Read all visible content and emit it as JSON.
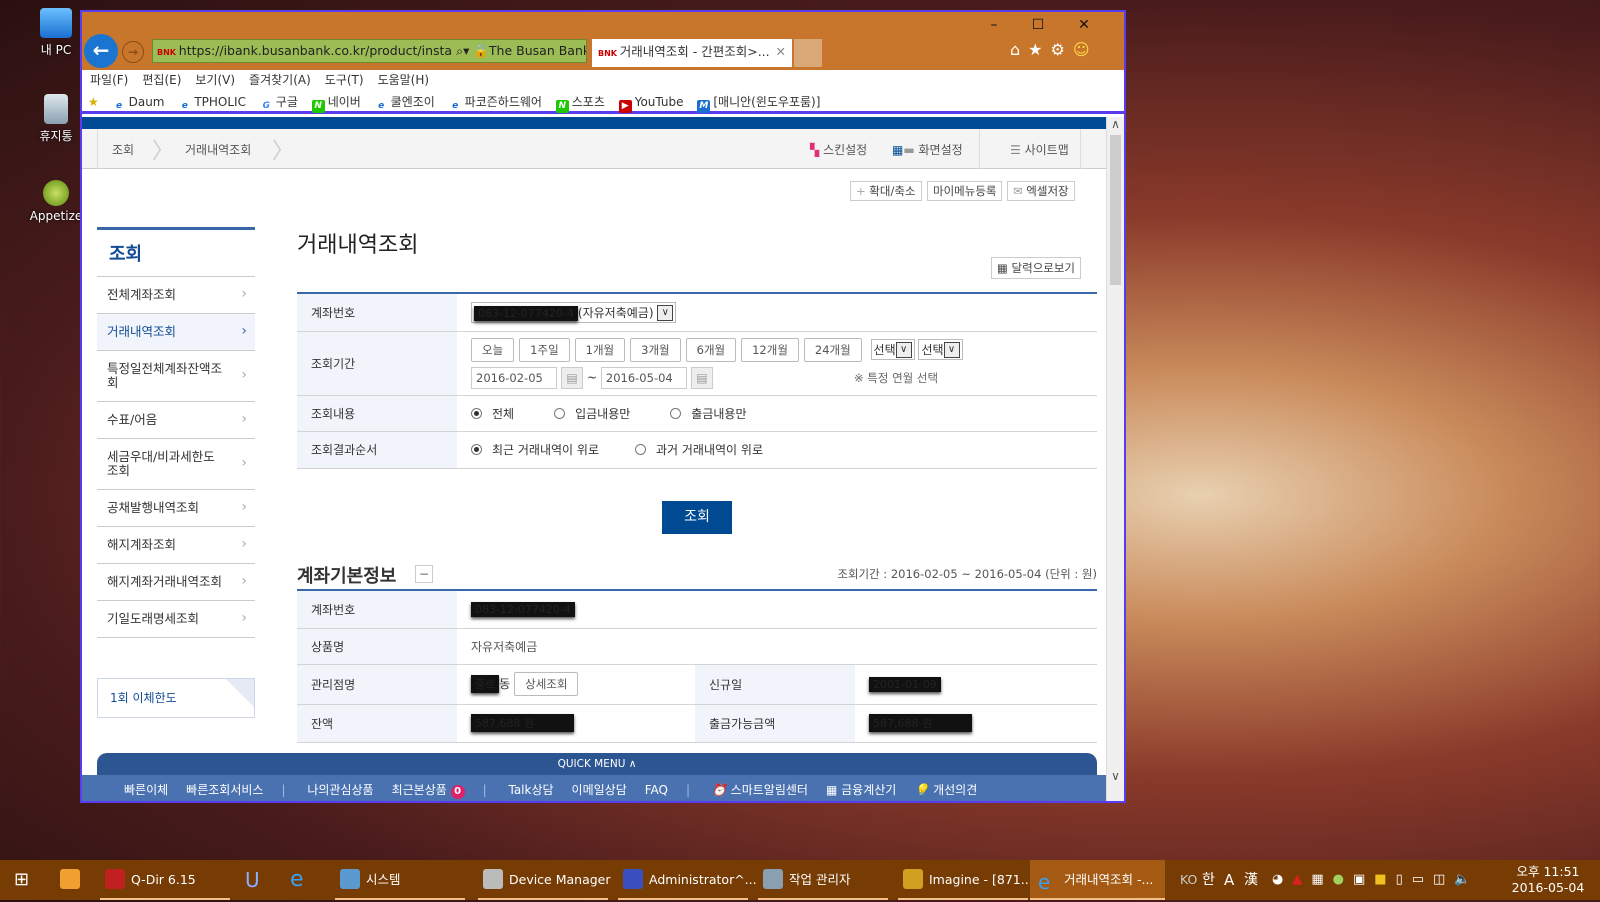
{
  "desktop": {
    "icons": [
      {
        "label": "내 PC",
        "icon": "pc-icon"
      },
      {
        "label": "휴지통",
        "icon": "recycle-bin-icon"
      },
      {
        "label": "Appetize",
        "icon": "appetize-icon"
      }
    ]
  },
  "browser": {
    "url": "https://ibank.busanbank.co.kr/product/insta",
    "site_identity": "The Busan Bank C...",
    "tab_title": "거래내역조회 - 간편조회>...",
    "menu": [
      "파일(F)",
      "편집(E)",
      "보기(V)",
      "즐겨찾기(A)",
      "도구(T)",
      "도움말(H)"
    ],
    "favorites": [
      "Daum",
      "TPHOLIC",
      "구글",
      "네이버",
      "쿨엔조이",
      "파코즌하드웨어",
      "스포츠",
      "YouTube",
      "[매니안(윈도우포룸)]"
    ]
  },
  "page": {
    "breadcrumb": [
      "조회",
      "거래내역조회"
    ],
    "top_links": {
      "skin": "스킨설정",
      "screen": "화면설정",
      "sitemap": "사이트맵"
    },
    "tools": {
      "zoom": "확대/축소",
      "mymenu": "마이메뉴등록",
      "excel": "엑셀저장"
    },
    "sidebar": {
      "title": "조회",
      "items": [
        "전체계좌조회",
        "거래내역조회",
        "특정일전체계좌잔액조회",
        "수표/어음",
        "세금우대/비과세한도조회",
        "공채발행내역조회",
        "해지계좌조회",
        "해지계좌거래내역조회",
        "기일도래명세조회"
      ],
      "active": 1,
      "box": "1회 이체한도"
    },
    "title": "거래내역조회",
    "calendar_btn": "달력으로보기",
    "form": {
      "account_label": "계좌번호",
      "account_value": "083-12-077420-4",
      "account_type": "(자유저축예금)",
      "period_label": "조회기간",
      "period_buttons": [
        "오늘",
        "1주일",
        "1개월",
        "3개월",
        "6개월",
        "12개월",
        "24개월"
      ],
      "year_select": "선택",
      "month_select": "선택",
      "from": "2016-02-05",
      "to": "2016-05-04",
      "tilde": "~",
      "month_note": "※ 특정 연월 선택",
      "content_label": "조회내용",
      "content_options": [
        "전체",
        "입금내용만",
        "출금내용만"
      ],
      "content_selected": 0,
      "order_label": "조회결과순서",
      "order_options": [
        "최근 거래내역이 위로",
        "과거 거래내역이 위로"
      ],
      "order_selected": 0,
      "submit": "조회"
    },
    "info": {
      "title": "계좌기본정보",
      "collapse": "−",
      "period_note": "조회기간 : 2016-02-05 ~ 2016-05-04 (단위 : 원)",
      "account_label": "계좌번호",
      "account_value": "083-12-077420-4",
      "product_label": "상품명",
      "product_value": "자유저축예금",
      "branch_label": "관리점명",
      "branch_value": "동",
      "branch_redacted": "중로",
      "detail_btn": "상세조회",
      "open_label": "신규일",
      "open_value": "2001-01-09",
      "balance_label": "잔액",
      "balance_value": "587,688 원",
      "withdrawable_label": "출금가능금액",
      "withdrawable_value": "587,688 원"
    },
    "quick_menu": {
      "label": "QUICK MENU",
      "items": [
        "빠른이체",
        "빠른조회서비스",
        "나의관심상품",
        "최근본상품",
        "Talk상담",
        "이메일상담",
        "FAQ",
        "스마트알림센터",
        "금융계산기",
        "개선의견"
      ],
      "recent_count": "0"
    }
  },
  "taskbar": {
    "items": [
      "Q-Dir 6.15",
      "시스템",
      "Device Manager",
      "Administrator^...",
      "작업 관리자",
      "Imagine - [871...",
      "거래내역조회 -..."
    ],
    "tray": {
      "lang": "KO",
      "ime": "한",
      "ime2": "A",
      "hanja": "漢",
      "ampm": "오후 11:51",
      "date": "2016-05-04"
    }
  },
  "colors": {
    "brand": "#004a94",
    "titlebar": "#c8762c",
    "taskbar": "#773b04"
  }
}
